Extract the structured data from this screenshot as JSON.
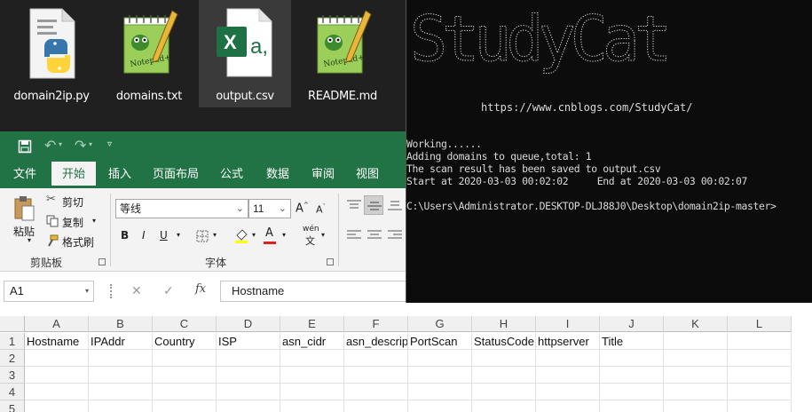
{
  "explorer": {
    "files": [
      {
        "name": "domain2ip.py",
        "icon": "python-file-icon"
      },
      {
        "name": "domains.txt",
        "icon": "notepad-plus-plus-icon"
      },
      {
        "name": "output.csv",
        "icon": "excel-csv-icon"
      },
      {
        "name": "README.md",
        "icon": "notepad-plus-plus-icon"
      }
    ]
  },
  "excel": {
    "tabs": [
      "文件",
      "开始",
      "插入",
      "页面布局",
      "公式",
      "数据",
      "审阅",
      "视图"
    ],
    "active_tab": "开始",
    "clipboard": {
      "paste_label": "粘贴",
      "cut_label": "剪切",
      "copy_label": "复制",
      "format_painter_label": "格式刷",
      "group_label": "剪贴板"
    },
    "font": {
      "font_name": "等线",
      "font_size": "11",
      "group_label": "字体",
      "bold": "B",
      "italic": "I",
      "underline": "U",
      "font_color_letter": "A",
      "phonetic_label": "wén"
    },
    "formula_bar": {
      "name_box": "A1",
      "fx_label": "fx",
      "content": "Hostname"
    },
    "columns": [
      "A",
      "B",
      "C",
      "D",
      "E",
      "F",
      "G",
      "H",
      "I",
      "J",
      "K",
      "L"
    ],
    "rows": [
      "1",
      "2",
      "3",
      "4",
      "5"
    ],
    "row1": [
      "Hostname",
      "IPAddr",
      "Country",
      "ISP",
      "asn_cidr",
      "asn_descrip",
      "PortScan",
      "StatusCode",
      "httpserver",
      "Title",
      "",
      ""
    ],
    "colors": {
      "excel_green": "#217346",
      "explorer_bg": "#202020",
      "terminal_bg": "#0c0c0c"
    }
  },
  "terminal": {
    "banner": "StudyCat",
    "url": "https://www.cnblogs.com/StudyCat/",
    "lines": [
      "Working......",
      "Adding domains to queue,total: 1",
      "The scan result has been saved to output.csv",
      "Start at 2020-03-03 00:02:02     End at 2020-03-03 00:02:07",
      "",
      "C:\\Users\\Administrator.DESKTOP-DLJ88J0\\Desktop\\domain2ip-master>"
    ]
  }
}
